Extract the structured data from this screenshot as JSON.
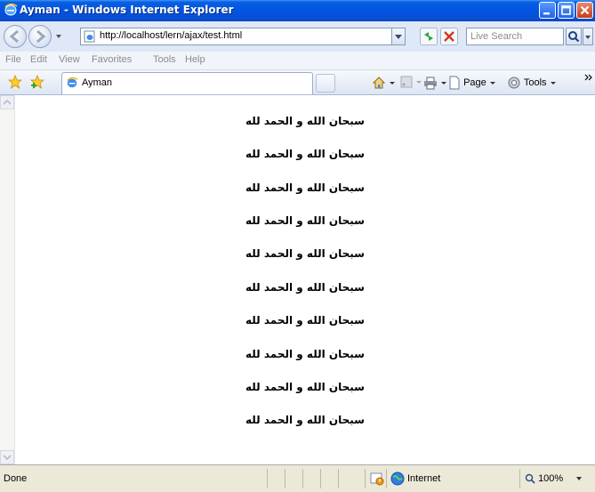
{
  "window": {
    "title": "Ayman - Windows Internet Explorer",
    "accent": "#0054e3"
  },
  "address_bar": {
    "url": "http://localhost/lern/ajax/test.html",
    "search_placeholder": "Live Search"
  },
  "menu": {
    "items": [
      "File",
      "Edit",
      "View",
      "Favorites",
      "Tools",
      "Help"
    ]
  },
  "tabs": [
    {
      "label": "Ayman"
    }
  ],
  "commands": {
    "page": "Page",
    "tools": "Tools"
  },
  "content": {
    "lines": [
      "سبحان الله و الحمد لله",
      "سبحان الله و الحمد لله",
      "سبحان الله و الحمد لله",
      "سبحان الله و الحمد لله",
      "سبحان الله و الحمد لله",
      "سبحان الله و الحمد لله",
      "سبحان الله و الحمد لله",
      "سبحان الله و الحمد لله",
      "سبحان الله و الحمد لله",
      "سبحان الله و الحمد لله"
    ]
  },
  "status": {
    "text": "Done",
    "zone": "Internet",
    "zoom": "100%"
  }
}
